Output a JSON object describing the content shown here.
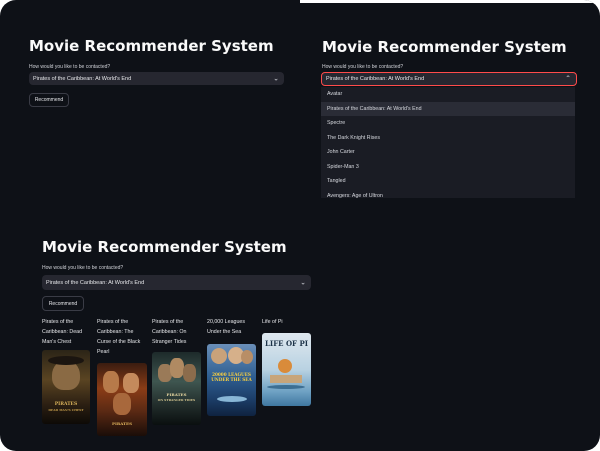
{
  "app": {
    "title": "Movie Recommender System",
    "prompt_label": "How would you like to be contacted?",
    "selected_movie": "Pirates of the Caribbean: At World's End",
    "recommend_button": "Recommend"
  },
  "dropdown": {
    "options": [
      "Avatar",
      "Pirates of the Caribbean: At World's End",
      "Spectre",
      "The Dark Knight Rises",
      "John Carter",
      "Spider-Man 3",
      "Tangled",
      "Avengers: Age of Ultron"
    ],
    "selected_index": 1
  },
  "recommendations": [
    {
      "title": "Pirates of the Caribbean: Dead Man's Chest",
      "poster_icon": "pirates-dead-mans-chest-poster"
    },
    {
      "title": "Pirates of the Caribbean: The Curse of the Black Pearl",
      "poster_icon": "pirates-black-pearl-poster"
    },
    {
      "title": "Pirates of the Caribbean: On Stranger Tides",
      "poster_icon": "pirates-stranger-tides-poster"
    },
    {
      "title": "20,000 Leagues Under the Sea",
      "poster_icon": "twenty-thousand-leagues-poster",
      "poster_text": "20000 LEAGUES UNDER THE SEA"
    },
    {
      "title": "Life of Pi",
      "poster_icon": "life-of-pi-poster",
      "poster_text": "LIFE OF PI"
    }
  ],
  "colors": {
    "background": "#0e1117",
    "widget": "#262730",
    "focus_border": "#ff4b4b",
    "text": "#fafafa"
  }
}
